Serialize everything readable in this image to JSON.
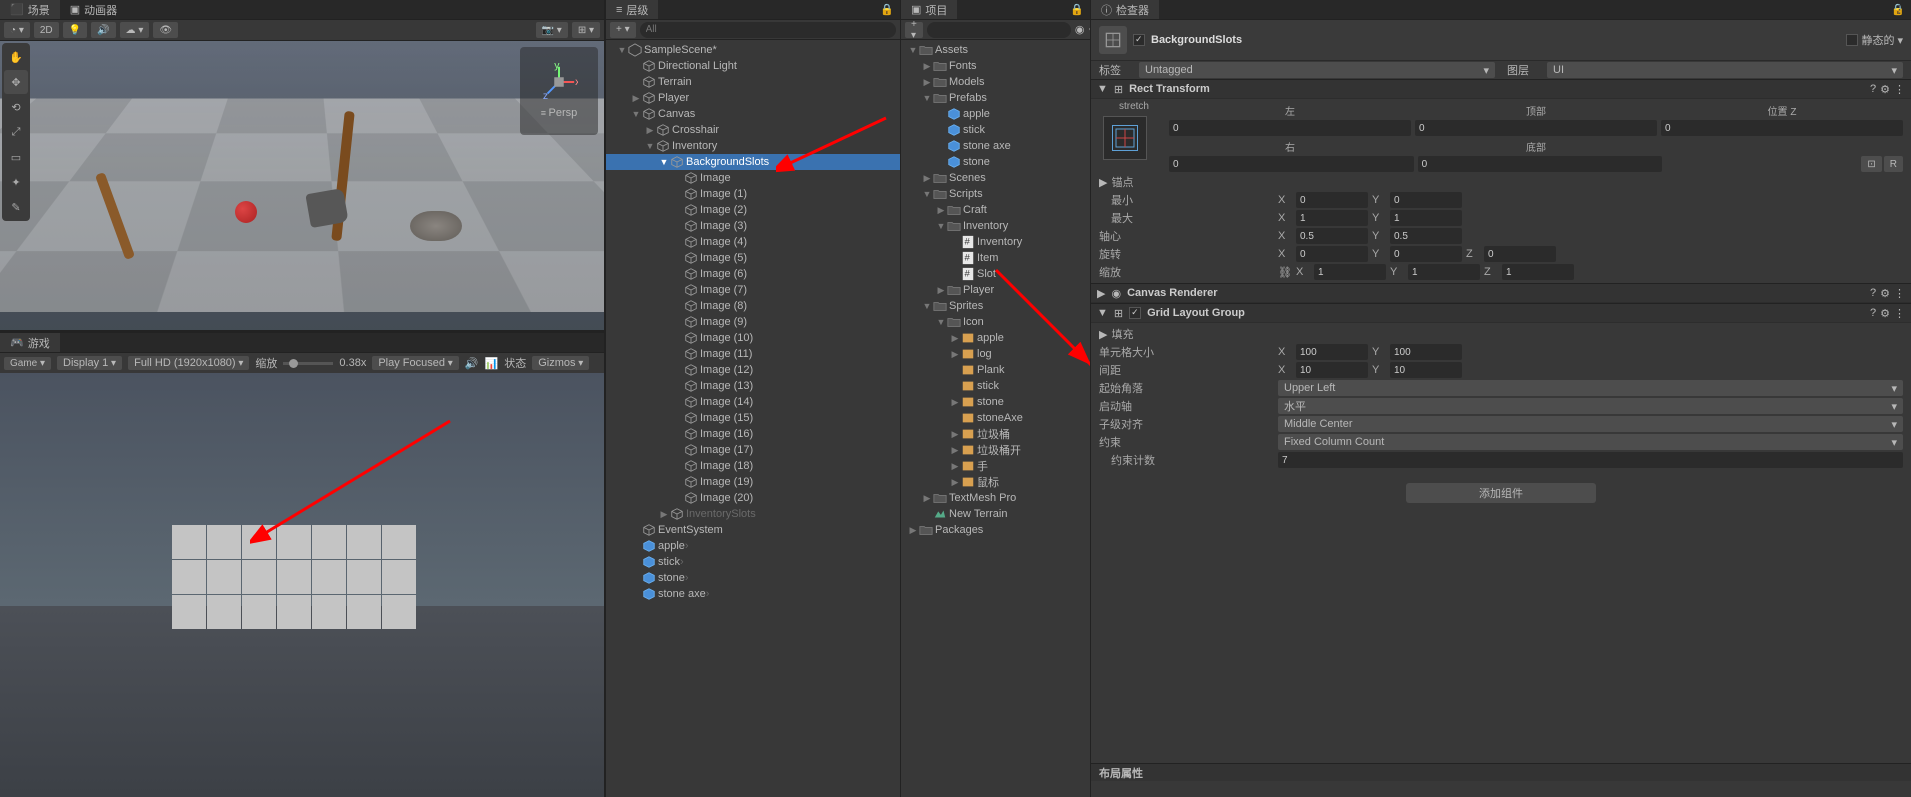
{
  "scene_panel": {
    "tab_scene": "场景",
    "tab_anim": "动画器",
    "btn_2d": "2D",
    "gizmo_mode": "Persp"
  },
  "game_panel": {
    "tab": "游戏",
    "display": "Display 1",
    "resolution": "Full HD (1920x1080)",
    "scale_label": "缩放",
    "scale_value": "0.38x",
    "play_mode": "Play Focused",
    "status": "状态",
    "gizmos": "Gizmos"
  },
  "hierarchy": {
    "tab": "层级",
    "search_placeholder": "All",
    "items": [
      {
        "lvl": 0,
        "icon": "unity",
        "label": "SampleScene*",
        "fold": "▼"
      },
      {
        "lvl": 1,
        "icon": "go",
        "label": "Directional Light"
      },
      {
        "lvl": 1,
        "icon": "go",
        "label": "Terrain"
      },
      {
        "lvl": 1,
        "icon": "go",
        "label": "Player",
        "fold": "▶"
      },
      {
        "lvl": 1,
        "icon": "go",
        "label": "Canvas",
        "fold": "▼"
      },
      {
        "lvl": 2,
        "icon": "go",
        "label": "Crosshair",
        "fold": "▶"
      },
      {
        "lvl": 2,
        "icon": "go",
        "label": "Inventory",
        "fold": "▼"
      },
      {
        "lvl": 3,
        "icon": "go",
        "label": "BackgroundSlots",
        "fold": "▼",
        "selected": true
      },
      {
        "lvl": 4,
        "icon": "go",
        "label": "Image"
      },
      {
        "lvl": 4,
        "icon": "go",
        "label": "Image (1)"
      },
      {
        "lvl": 4,
        "icon": "go",
        "label": "Image (2)"
      },
      {
        "lvl": 4,
        "icon": "go",
        "label": "Image (3)"
      },
      {
        "lvl": 4,
        "icon": "go",
        "label": "Image (4)"
      },
      {
        "lvl": 4,
        "icon": "go",
        "label": "Image (5)"
      },
      {
        "lvl": 4,
        "icon": "go",
        "label": "Image (6)"
      },
      {
        "lvl": 4,
        "icon": "go",
        "label": "Image (7)"
      },
      {
        "lvl": 4,
        "icon": "go",
        "label": "Image (8)"
      },
      {
        "lvl": 4,
        "icon": "go",
        "label": "Image (9)"
      },
      {
        "lvl": 4,
        "icon": "go",
        "label": "Image (10)"
      },
      {
        "lvl": 4,
        "icon": "go",
        "label": "Image (11)"
      },
      {
        "lvl": 4,
        "icon": "go",
        "label": "Image (12)"
      },
      {
        "lvl": 4,
        "icon": "go",
        "label": "Image (13)"
      },
      {
        "lvl": 4,
        "icon": "go",
        "label": "Image (14)"
      },
      {
        "lvl": 4,
        "icon": "go",
        "label": "Image (15)"
      },
      {
        "lvl": 4,
        "icon": "go",
        "label": "Image (16)"
      },
      {
        "lvl": 4,
        "icon": "go",
        "label": "Image (17)"
      },
      {
        "lvl": 4,
        "icon": "go",
        "label": "Image (18)"
      },
      {
        "lvl": 4,
        "icon": "go",
        "label": "Image (19)"
      },
      {
        "lvl": 4,
        "icon": "go",
        "label": "Image (20)"
      },
      {
        "lvl": 3,
        "icon": "go",
        "label": "InventorySlots",
        "fold": "▶",
        "dim": true
      },
      {
        "lvl": 1,
        "icon": "go",
        "label": "EventSystem"
      },
      {
        "lvl": 1,
        "icon": "prefab",
        "label": "apple",
        "chev": true
      },
      {
        "lvl": 1,
        "icon": "prefab",
        "label": "stick",
        "chev": true
      },
      {
        "lvl": 1,
        "icon": "prefab",
        "label": "stone",
        "chev": true
      },
      {
        "lvl": 1,
        "icon": "prefab",
        "label": "stone axe",
        "chev": true
      }
    ]
  },
  "project": {
    "tab": "项目",
    "vis_count": "14",
    "items": [
      {
        "lvl": 0,
        "icon": "folder",
        "label": "Assets",
        "fold": "▼"
      },
      {
        "lvl": 1,
        "icon": "folder",
        "label": "Fonts",
        "fold": "▶"
      },
      {
        "lvl": 1,
        "icon": "folder",
        "label": "Models",
        "fold": "▶"
      },
      {
        "lvl": 1,
        "icon": "folder",
        "label": "Prefabs",
        "fold": "▼"
      },
      {
        "lvl": 2,
        "icon": "prefab",
        "label": "apple"
      },
      {
        "lvl": 2,
        "icon": "prefab",
        "label": "stick"
      },
      {
        "lvl": 2,
        "icon": "prefab",
        "label": "stone axe"
      },
      {
        "lvl": 2,
        "icon": "prefab",
        "label": "stone"
      },
      {
        "lvl": 1,
        "icon": "folder",
        "label": "Scenes",
        "fold": "▶"
      },
      {
        "lvl": 1,
        "icon": "folder",
        "label": "Scripts",
        "fold": "▼"
      },
      {
        "lvl": 2,
        "icon": "folder",
        "label": "Craft",
        "fold": "▶"
      },
      {
        "lvl": 2,
        "icon": "folder",
        "label": "Inventory",
        "fold": "▼"
      },
      {
        "lvl": 3,
        "icon": "cs",
        "label": "Inventory"
      },
      {
        "lvl": 3,
        "icon": "cs",
        "label": "Item"
      },
      {
        "lvl": 3,
        "icon": "cs",
        "label": "Slot"
      },
      {
        "lvl": 2,
        "icon": "folder",
        "label": "Player",
        "fold": "▶"
      },
      {
        "lvl": 1,
        "icon": "folder",
        "label": "Sprites",
        "fold": "▼"
      },
      {
        "lvl": 2,
        "icon": "folder",
        "label": "Icon",
        "fold": "▼"
      },
      {
        "lvl": 3,
        "icon": "imgfold",
        "label": "apple",
        "fold": "▶"
      },
      {
        "lvl": 3,
        "icon": "imgfold",
        "label": "log",
        "fold": "▶"
      },
      {
        "lvl": 3,
        "icon": "img",
        "label": "Plank"
      },
      {
        "lvl": 3,
        "icon": "img",
        "label": "stick"
      },
      {
        "lvl": 3,
        "icon": "imgfold",
        "label": "stone",
        "fold": "▶"
      },
      {
        "lvl": 3,
        "icon": "img",
        "label": "stoneAxe"
      },
      {
        "lvl": 3,
        "icon": "imgfold",
        "label": "垃圾桶",
        "fold": "▶"
      },
      {
        "lvl": 3,
        "icon": "imgfold",
        "label": "垃圾桶开",
        "fold": "▶"
      },
      {
        "lvl": 3,
        "icon": "imgfold",
        "label": "手",
        "fold": "▶"
      },
      {
        "lvl": 3,
        "icon": "imgfold",
        "label": "鼠标",
        "fold": "▶"
      },
      {
        "lvl": 1,
        "icon": "folder",
        "label": "TextMesh Pro",
        "fold": "▶"
      },
      {
        "lvl": 1,
        "icon": "terrain",
        "label": "New Terrain"
      },
      {
        "lvl": 0,
        "icon": "folder",
        "label": "Packages",
        "fold": "▶"
      }
    ]
  },
  "inspector": {
    "tab": "检查器",
    "obj_name": "BackgroundSlots",
    "static_label": "静态的",
    "tag_label": "标签",
    "tag_value": "Untagged",
    "layer_label": "图层",
    "layer_value": "UI",
    "rect": {
      "title": "Rect Transform",
      "stretch": "stretch",
      "left": "左",
      "top": "顶部",
      "posz": "位置 Z",
      "right": "右",
      "bottom": "底部",
      "left_v": "0",
      "top_v": "0",
      "posz_v": "0",
      "right_v": "0",
      "bottom_v": "0",
      "anchors": "锚点",
      "min": "最小",
      "max": "最大",
      "min_x": "0",
      "min_y": "0",
      "max_x": "1",
      "max_y": "1",
      "pivot": "轴心",
      "pivot_x": "0.5",
      "pivot_y": "0.5",
      "rotation": "旋转",
      "rot_x": "0",
      "rot_y": "0",
      "rot_z": "0",
      "scale": "缩放",
      "scale_x": "1",
      "scale_y": "1",
      "scale_z": "1",
      "R": "R"
    },
    "canvas_renderer": {
      "title": "Canvas Renderer"
    },
    "grid": {
      "title": "Grid Layout Group",
      "padding": "填充",
      "cell_size": "单元格大小",
      "cell_x": "100",
      "cell_y": "100",
      "spacing": "间距",
      "sp_x": "10",
      "sp_y": "10",
      "start_corner": "起始角落",
      "start_corner_v": "Upper Left",
      "start_axis": "启动轴",
      "start_axis_v": "水平",
      "child_align": "子级对齐",
      "child_align_v": "Middle Center",
      "constraint": "约束",
      "constraint_v": "Fixed Column Count",
      "constraint_count": "约束计数",
      "constraint_count_v": "7"
    },
    "add_component": "添加组件",
    "layout_props": "布局属性"
  }
}
